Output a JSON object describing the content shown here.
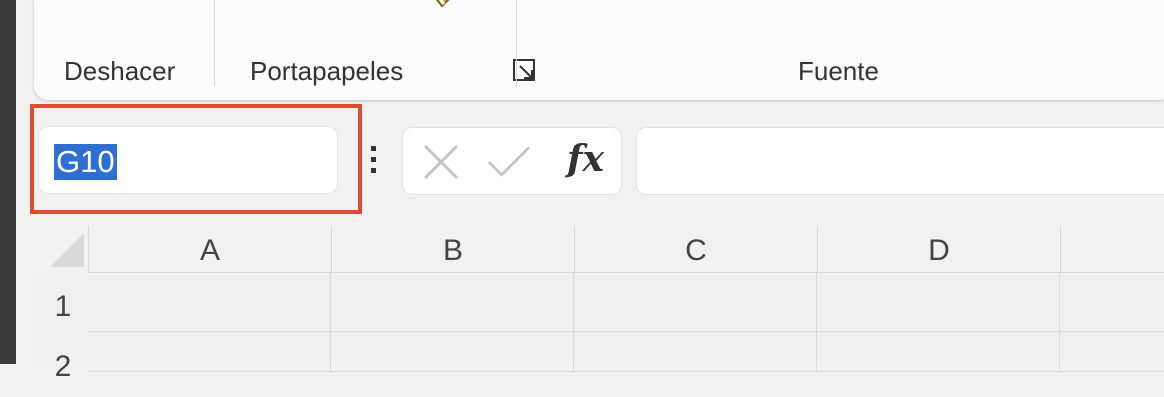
{
  "ribbon": {
    "groups": [
      {
        "label": "Deshacer"
      },
      {
        "label": "Portapapeles"
      },
      {
        "label": "Fuente"
      }
    ]
  },
  "name_box": {
    "value": "G10"
  },
  "formula_bar": {
    "function_label": "fx",
    "value": ""
  },
  "sheet": {
    "columns": [
      "A",
      "B",
      "C",
      "D"
    ],
    "rows": [
      "1",
      "2"
    ]
  },
  "colors": {
    "highlight": "#e04a35",
    "selection": "#2f6fd4"
  },
  "icons": [
    "format-painter-icon",
    "dialog-launcher-icon",
    "more-options-icon",
    "cancel-icon",
    "enter-icon"
  ]
}
